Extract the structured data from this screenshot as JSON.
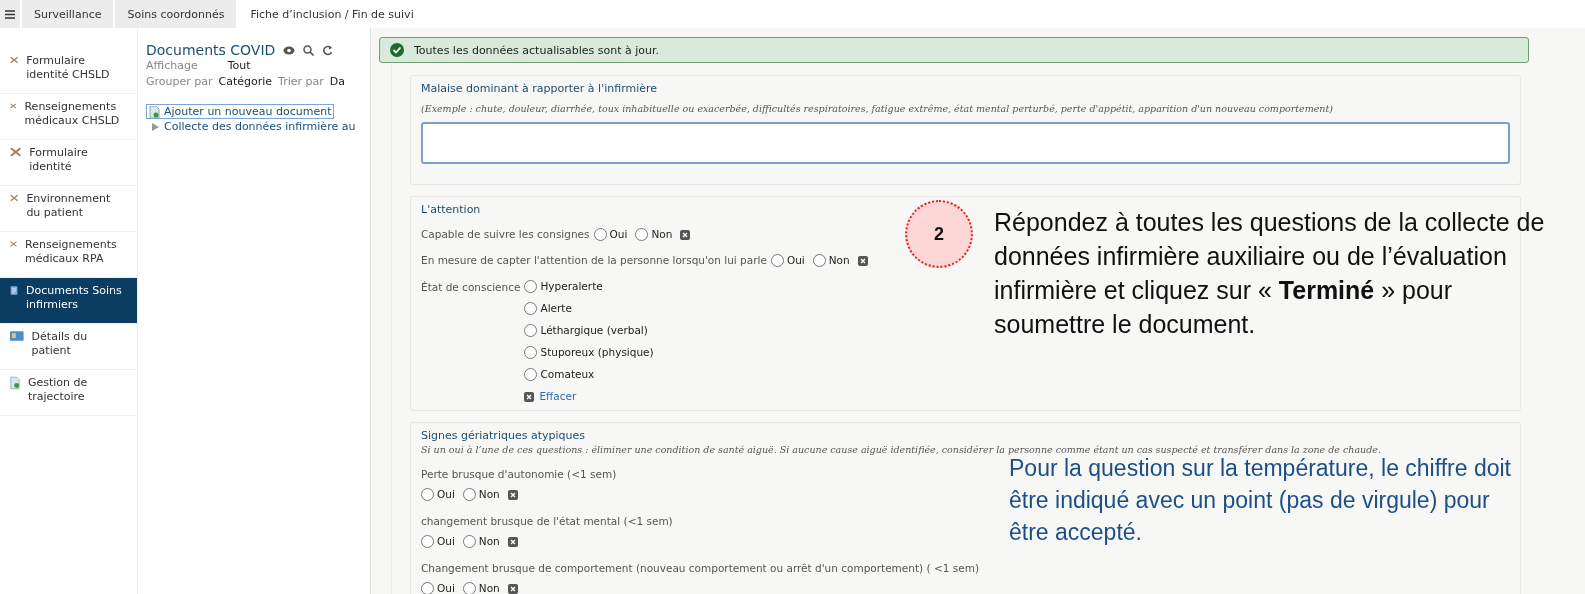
{
  "tabs": [
    {
      "label": "Surveillance",
      "selected": false
    },
    {
      "label": "Soins coordonnés",
      "selected": false
    },
    {
      "label": "Fiche d’inclusion / Fin de suivi",
      "selected": true
    }
  ],
  "sidebar": {
    "items": [
      {
        "label": "Formulaire identité CHSLD",
        "kind": "form",
        "selected": false
      },
      {
        "label": "Renseignements médicaux CHSLD",
        "kind": "form",
        "selected": false
      },
      {
        "label": "Formulaire identité",
        "kind": "form",
        "selected": false
      },
      {
        "label": "Environnement du patient",
        "kind": "form",
        "selected": false
      },
      {
        "label": "Renseignements médicaux RPA",
        "kind": "form",
        "selected": false
      },
      {
        "label": "Documents Soins infirmiers",
        "kind": "docs",
        "selected": true
      },
      {
        "label": "Détails du patient",
        "kind": "details",
        "selected": false
      },
      {
        "label": "Gestion de trajectoire",
        "kind": "route",
        "selected": false
      }
    ]
  },
  "documents": {
    "title": "Documents COVID",
    "filters": [
      {
        "label": "Affichage",
        "value": "Tout"
      },
      {
        "label": "Grouper par",
        "value": "Catégorie",
        "extra_label": "Trier par",
        "extra_value": "Da"
      }
    ],
    "add_button": "Ajouter un nouveau document",
    "tree": [
      {
        "label": "Collecte des données infirmière au",
        "expanded": false
      }
    ]
  },
  "banner": {
    "text": "Toutes les données actualisables sont à jour."
  },
  "sections": [
    {
      "title": "Malaise dominant à rapporter à l'infirmière",
      "note": "(Exemple : chute, douleur, diarrhée, toux inhabituelle ou exacerbée, difficultés respiratoires, fatigue extrême, état mental perturbé, perte d'appétit, apparition d'un nouveau comportement)",
      "kind": "text"
    },
    {
      "title": "L'attention",
      "kind": "inline",
      "questions": [
        {
          "label": "Capable de suivre les consignes",
          "kind": "inline",
          "options": [
            {
              "label": "Oui",
              "selected": false
            },
            {
              "label": "Non",
              "selected": false
            }
          ]
        },
        {
          "label": "En mesure de capter l'attention de la personne lorsqu'on lui parle",
          "kind": "inline",
          "options": [
            {
              "label": "Oui",
              "selected": false
            },
            {
              "label": "Non",
              "selected": false
            }
          ]
        },
        {
          "label": "État de conscience",
          "kind": "stack",
          "clear": "Effacer",
          "options": [
            {
              "label": "Hyperalerte",
              "selected": false
            },
            {
              "label": "Alerte",
              "selected": false
            },
            {
              "label": "Léthargique (verbal)",
              "selected": false
            },
            {
              "label": "Stuporeux (physique)",
              "selected": false
            },
            {
              "label": "Comateux",
              "selected": false
            }
          ]
        }
      ]
    },
    {
      "title": "Signes gériatriques atypiques",
      "kind": "below",
      "note": "Si un oui à l’une de ces questions : éliminer une condition de santé aiguë. Si aucune cause aiguë identifiée, considérer la personne comme étant un cas suspecté et transférer dans la zone de chaude.",
      "questions": [
        {
          "label": "Perte brusque d'autonomie (<1 sem)",
          "kind": "below",
          "options": [
            {
              "label": "Oui",
              "selected": false
            },
            {
              "label": "Non",
              "selected": false
            }
          ]
        },
        {
          "label": "changement brusque de l'état mental (<1 sem)",
          "kind": "below",
          "options": [
            {
              "label": "Oui",
              "selected": false
            },
            {
              "label": "Non",
              "selected": false
            }
          ]
        },
        {
          "label": "Changement brusque de comportement (nouveau comportement ou arrêt d'un comportement) ( <1 sem)",
          "kind": "below",
          "options": [
            {
              "label": "Oui",
              "selected": false
            },
            {
              "label": "Non",
              "selected": false
            }
          ]
        }
      ]
    }
  ],
  "annotations": [
    {
      "kind": "step",
      "number": "2",
      "text": "Répondez à toutes les questions de la collecte de données infirmière auxiliaire ou de l’évaluation infirmière et cliquez sur « **Terminé** » pour soumettre le document."
    },
    {
      "kind": "note",
      "text": "Pour la question sur la température, le chiffre doit être indiqué avec un point (pas de virgule) pour être accepté."
    }
  ]
}
